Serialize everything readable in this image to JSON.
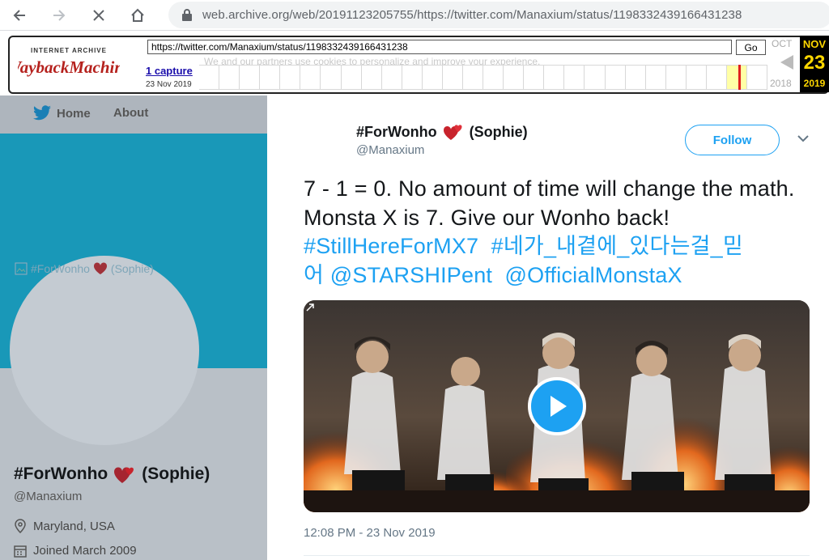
{
  "browser": {
    "url": "web.archive.org/web/20191123205755/https://twitter.com/Manaxium/status/1198332439166431238"
  },
  "wayback": {
    "logo_top": "INTERNET ARCHIVE",
    "logo_main": "WaybackMachine",
    "url_value": "https://twitter.com/Manaxium/status/1198332439166431238",
    "go_label": "Go",
    "captures": "1 capture",
    "capture_date": "23 Nov 2019",
    "prev_month": "OCT",
    "prev_year": "2018",
    "cur_month": "NOV",
    "cur_day": "23",
    "cur_year": "2019",
    "ghost_text": "We and our partners use cookies to personalize and improve your experience."
  },
  "profile": {
    "nav_home": "Home",
    "nav_about": "About",
    "broken_img_alt": "#ForWonho",
    "broken_img_alt2": "(Sophie)",
    "name": "#ForWonho",
    "name_suffix": "(Sophie)",
    "handle": "@Manaxium",
    "location": "Maryland, USA",
    "joined": "Joined March 2009"
  },
  "tweet": {
    "name": "#ForWonho",
    "name_suffix": "(Sophie)",
    "handle": "@Manaxium",
    "follow_label": "Follow",
    "text_main": "7 - 1 = 0. No amount of time will change the math. Monsta X is 7. Give our Wonho back! ",
    "hashtag1": "#StillHereForMX7",
    "hashtag2": "#네가_내곁에_있다는걸_믿어",
    "mention1": "@STARSHIPent",
    "mention2": "@OfficialMonstaX",
    "timestamp": "12:08 PM - 23 Nov 2019"
  },
  "colors": {
    "twitter_blue": "#1da1f2",
    "banner": "#1998b8",
    "wayback_gold": "#ffd700",
    "heart": "#c8232c"
  },
  "icons": [
    "back-icon",
    "forward-icon",
    "stop-icon",
    "home-icon",
    "lock-icon",
    "twitter-bird-icon",
    "heart-icon",
    "location-icon",
    "calendar-icon",
    "chevron-down-icon",
    "play-icon",
    "gif-icon"
  ]
}
